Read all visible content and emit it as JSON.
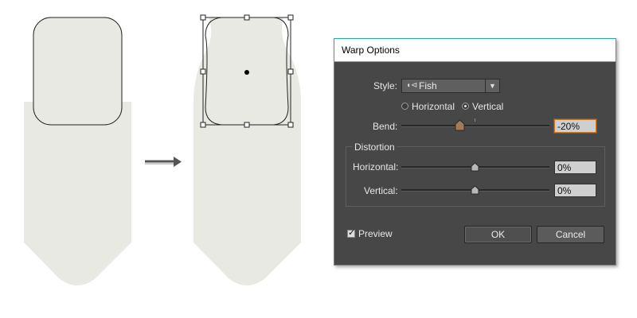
{
  "dialog": {
    "title": "Warp Options",
    "style_label": "Style:",
    "style_value": "Fish",
    "style_icon": "fish-icon",
    "orientation": {
      "horizontal_label": "Horizontal",
      "vertical_label": "Vertical",
      "selected": "Vertical"
    },
    "bend": {
      "label": "Bend:",
      "value": "-20%",
      "slider_fraction": 0.4
    },
    "distortion": {
      "title": "Distortion",
      "horizontal": {
        "label": "Horizontal:",
        "value": "0%",
        "slider_fraction": 0.5
      },
      "vertical": {
        "label": "Vertical:",
        "value": "0%",
        "slider_fraction": 0.5
      }
    },
    "preview": {
      "label": "Preview",
      "checked": true
    },
    "ok_label": "OK",
    "cancel_label": "Cancel"
  },
  "colors": {
    "shape_fill": "#e8e9e2",
    "dialog_bg": "#474747",
    "dialog_border": "#2aa7a7",
    "arrow": "#555555"
  }
}
